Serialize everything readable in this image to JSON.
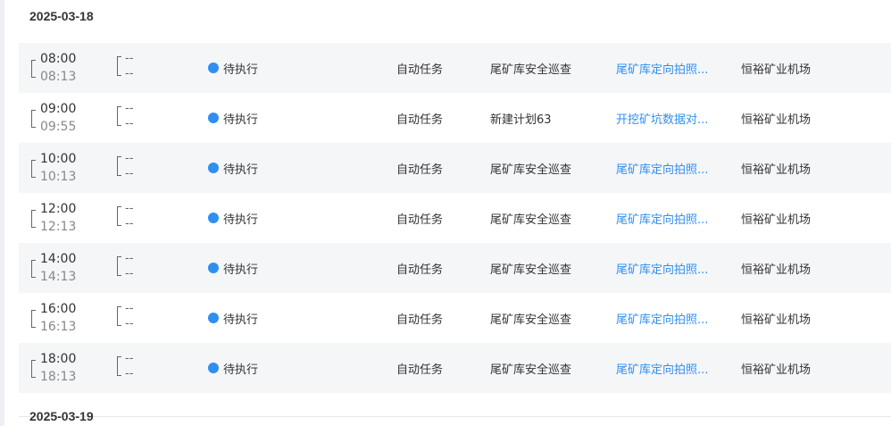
{
  "dates": [
    "2025-03-18",
    "2025-03-19"
  ],
  "colors": {
    "accent": "#2f8ff0",
    "shaded_row": "#f5f6f8"
  },
  "rows": [
    {
      "start": "08:00",
      "end": "08:13",
      "actual_start": "--",
      "actual_end": "--",
      "status": "待执行",
      "type": "自动任务",
      "plan": "尾矿库安全巡查",
      "route": "尾矿库定向拍照...",
      "site": "恒裕矿业机场"
    },
    {
      "start": "09:00",
      "end": "09:55",
      "actual_start": "--",
      "actual_end": "--",
      "status": "待执行",
      "type": "自动任务",
      "plan": "新建计划63",
      "route": "开挖矿坑数据对...",
      "site": "恒裕矿业机场"
    },
    {
      "start": "10:00",
      "end": "10:13",
      "actual_start": "--",
      "actual_end": "--",
      "status": "待执行",
      "type": "自动任务",
      "plan": "尾矿库安全巡查",
      "route": "尾矿库定向拍照...",
      "site": "恒裕矿业机场"
    },
    {
      "start": "12:00",
      "end": "12:13",
      "actual_start": "--",
      "actual_end": "--",
      "status": "待执行",
      "type": "自动任务",
      "plan": "尾矿库安全巡查",
      "route": "尾矿库定向拍照...",
      "site": "恒裕矿业机场"
    },
    {
      "start": "14:00",
      "end": "14:13",
      "actual_start": "--",
      "actual_end": "--",
      "status": "待执行",
      "type": "自动任务",
      "plan": "尾矿库安全巡查",
      "route": "尾矿库定向拍照...",
      "site": "恒裕矿业机场"
    },
    {
      "start": "16:00",
      "end": "16:13",
      "actual_start": "--",
      "actual_end": "--",
      "status": "待执行",
      "type": "自动任务",
      "plan": "尾矿库安全巡查",
      "route": "尾矿库定向拍照...",
      "site": "恒裕矿业机场"
    },
    {
      "start": "18:00",
      "end": "18:13",
      "actual_start": "--",
      "actual_end": "--",
      "status": "待执行",
      "type": "自动任务",
      "plan": "尾矿库安全巡查",
      "route": "尾矿库定向拍照...",
      "site": "恒裕矿业机场"
    }
  ]
}
